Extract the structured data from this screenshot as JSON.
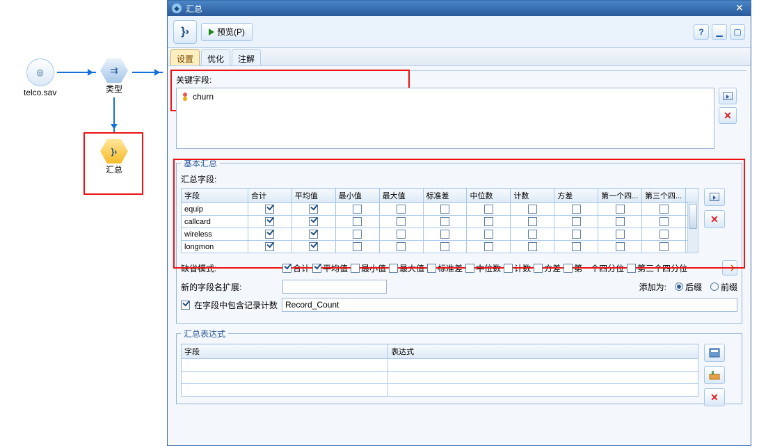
{
  "canvas": {
    "nodes": {
      "source": {
        "label": "telco.sav"
      },
      "type": {
        "label": "类型"
      },
      "agg": {
        "label": "汇总"
      }
    }
  },
  "dialog": {
    "title": "汇总",
    "preview_label": "预览(P)",
    "tabs": {
      "settings": "设置",
      "optimize": "优化",
      "annotate": "注解"
    },
    "keyfield": {
      "label": "关键字段:",
      "items": [
        "churn"
      ]
    },
    "basic": {
      "legend": "基本汇总",
      "summary_fields_label": "汇总字段:",
      "columns": [
        "字段",
        "合计",
        "平均值",
        "最小值",
        "最大值",
        "标准差",
        "中位数",
        "计数",
        "方差",
        "第一个四...",
        "第三个四..."
      ],
      "rows": [
        {
          "field": "equip",
          "sum": true,
          "mean": true,
          "min": false,
          "max": false,
          "sd": false,
          "median": false,
          "count": false,
          "var": false,
          "q1": false,
          "q3": false
        },
        {
          "field": "callcard",
          "sum": true,
          "mean": true,
          "min": false,
          "max": false,
          "sd": false,
          "median": false,
          "count": false,
          "var": false,
          "q1": false,
          "q3": false
        },
        {
          "field": "wireless",
          "sum": true,
          "mean": true,
          "min": false,
          "max": false,
          "sd": false,
          "median": false,
          "count": false,
          "var": false,
          "q1": false,
          "q3": false
        },
        {
          "field": "longmon",
          "sum": true,
          "mean": true,
          "min": false,
          "max": false,
          "sd": false,
          "median": false,
          "count": false,
          "var": false,
          "q1": false,
          "q3": false
        }
      ],
      "default_mode_label": "缺省模式:",
      "default_checks": {
        "sum": true,
        "mean": true,
        "min": false,
        "max": false,
        "sd": false,
        "median": false,
        "count": false,
        "var": false,
        "q1": false,
        "q3": false
      },
      "default_labels": {
        "sum": "合计",
        "mean": "平均值",
        "min": "最小值",
        "max": "最大值",
        "sd": "标准差",
        "median": "中位数",
        "count": "计数",
        "var": "方差",
        "q1": "第一个四分位",
        "q3": "第三个四分位"
      },
      "new_name_ext_label": "新的字段名扩展:",
      "new_name_ext_value": "",
      "add_as_label": "添加为:",
      "add_as_suffix": "后缀",
      "add_as_prefix": "前缀",
      "add_as_selected": "suffix",
      "include_count_checked": true,
      "include_count_label": "在字段中包含记录计数",
      "record_count_value": "Record_Count"
    },
    "expr": {
      "legend": "汇总表达式",
      "col_field": "字段",
      "col_expr": "表达式"
    }
  }
}
